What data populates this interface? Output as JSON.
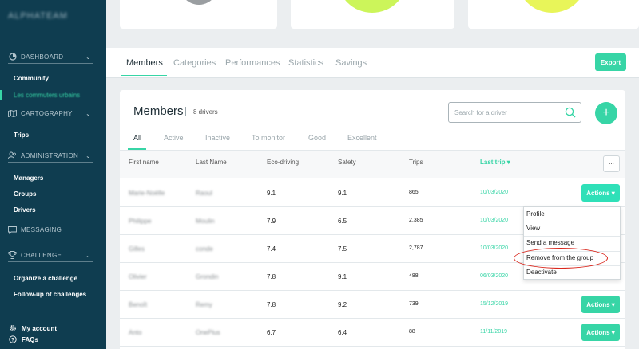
{
  "sidebar": {
    "brand": "ALPHATEAM",
    "sections": {
      "dashboard": "DASHBOARD",
      "cartography": "CARTOGRAPHY",
      "administration": "ADMINISTRATION",
      "messaging": "MESSAGING",
      "challenge": "CHALLENGE"
    },
    "links": {
      "community": "Community",
      "urban_commuters": "Les commuters urbains",
      "trips": "Trips",
      "managers": "Managers",
      "groups": "Groups",
      "drivers": "Drivers",
      "organize_challenge": "Organize a challenge",
      "followup_challenges": "Follow-up of challenges"
    },
    "footer": {
      "my_account": "My account",
      "faqs": "FAQs"
    }
  },
  "tabs": [
    "Members",
    "Categories",
    "Performances",
    "Statistics",
    "Savings"
  ],
  "export_label": "Export",
  "members": {
    "title": "Members",
    "count": "8 drivers",
    "search_placeholder": "Search for a driver",
    "add_label": "+"
  },
  "filters": [
    "All",
    "Active",
    "Inactive",
    "To monitor",
    "Good",
    "Excellent"
  ],
  "columns": {
    "first_name": "First name",
    "last_name": "Last Name",
    "eco": "Eco-driving",
    "safety": "Safety",
    "trips": "Trips",
    "last_trip": "Last trip ▾",
    "more": "..."
  },
  "rows": [
    {
      "first": "Marie-Noëlle",
      "last": "Raoul",
      "eco": "9.1",
      "safety": "9.1",
      "trips": "865",
      "date": "10/03/2020",
      "action": "Actions ▾"
    },
    {
      "first": "Philippe",
      "last": "Moulin",
      "eco": "7.9",
      "safety": "6.5",
      "trips": "2,385",
      "date": "10/03/2020",
      "action": ""
    },
    {
      "first": "Gilles",
      "last": "conde",
      "eco": "7.4",
      "safety": "7.5",
      "trips": "2,787",
      "date": "10/03/2020",
      "action": ""
    },
    {
      "first": "Olivier",
      "last": "Grondin",
      "eco": "7.8",
      "safety": "9.1",
      "trips": "488",
      "date": "06/03/2020",
      "action": ""
    },
    {
      "first": "Benoît",
      "last": "Remy",
      "eco": "7.8",
      "safety": "9.2",
      "trips": "739",
      "date": "15/12/2019",
      "action": "Actions ▾"
    },
    {
      "first": "Anto",
      "last": "OnePlus",
      "eco": "6.7",
      "safety": "6.4",
      "trips": "88",
      "date": "11/11/2019",
      "action": "Actions ▾"
    }
  ],
  "dropdown": [
    "Profile",
    "View",
    "Send a message",
    "Remove from the group",
    "Deactivate"
  ],
  "colors": {
    "sidebar": "#0f3d50",
    "accent": "#37d5a6",
    "annotation": "#d9281e"
  }
}
